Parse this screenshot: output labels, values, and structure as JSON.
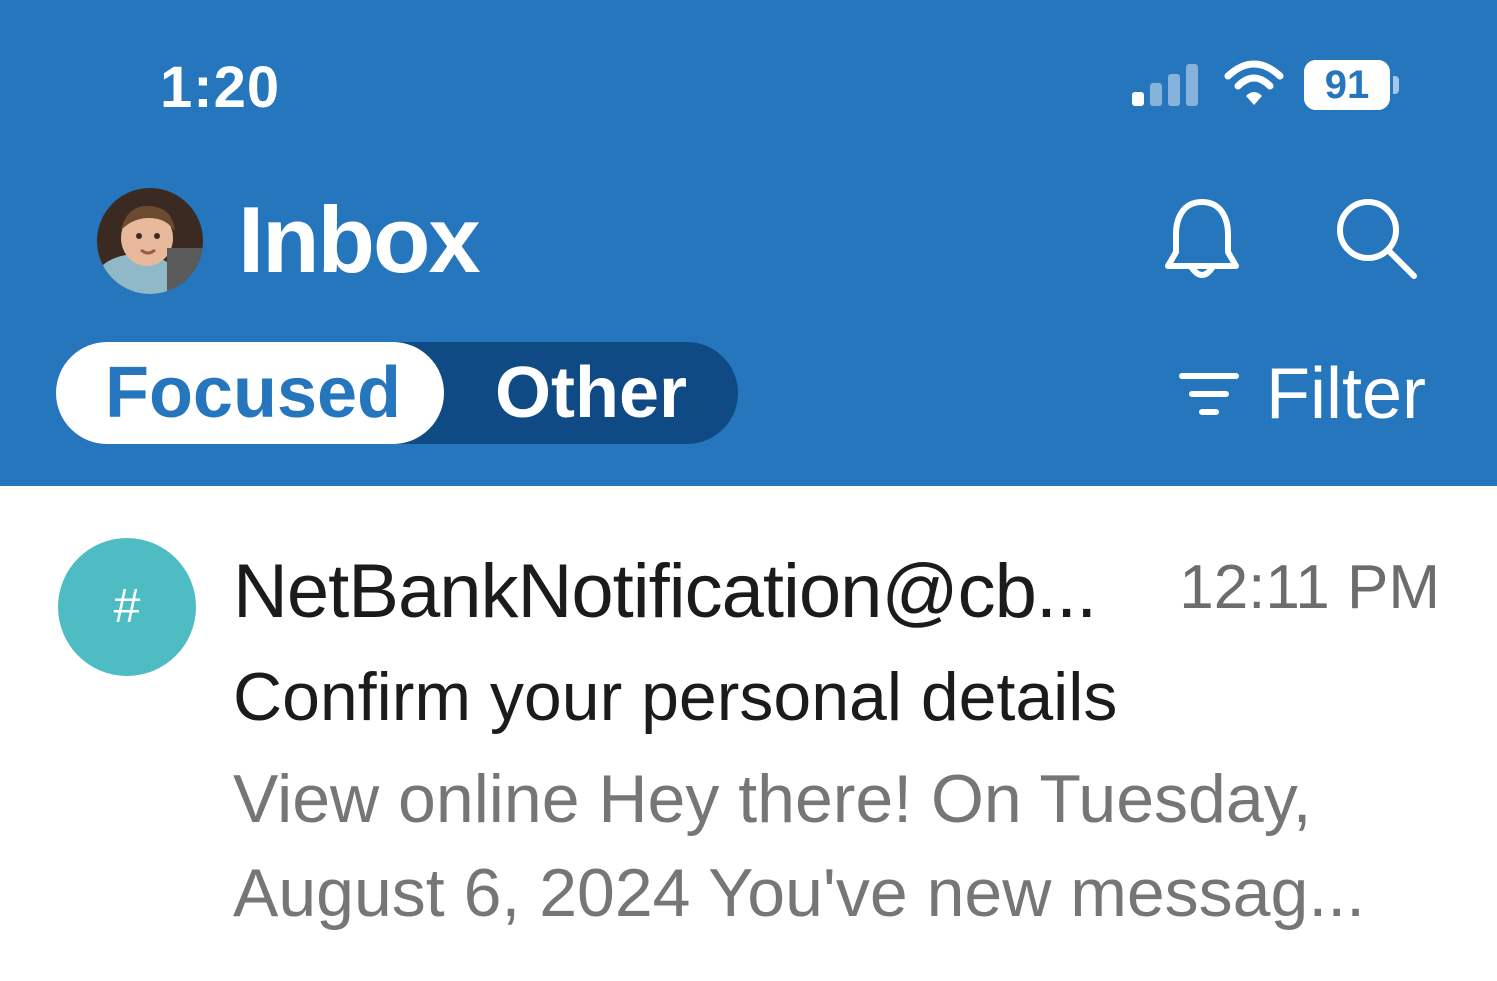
{
  "status_bar": {
    "time": "1:20",
    "battery": "91",
    "battery_level_percent": 91
  },
  "header": {
    "title": "Inbox",
    "bell_icon": "bell-icon",
    "search_icon": "search-icon"
  },
  "tabs": {
    "focused": "Focused",
    "other": "Other",
    "selected": "Focused"
  },
  "filter": {
    "label": "Filter",
    "icon": "filter-icon"
  },
  "colors": {
    "header_bg": "#2576bd",
    "segment_bg": "#0f4a85",
    "sender_avatar": "#4dbdc3"
  },
  "messages": [
    {
      "avatar_text": "#",
      "sender": "NetBankNotification@cb...",
      "time": "12:11 PM",
      "subject": "Confirm your personal details",
      "preview": "View online Hey there! On Tuesday, August 6, 2024 You've new messag..."
    }
  ]
}
